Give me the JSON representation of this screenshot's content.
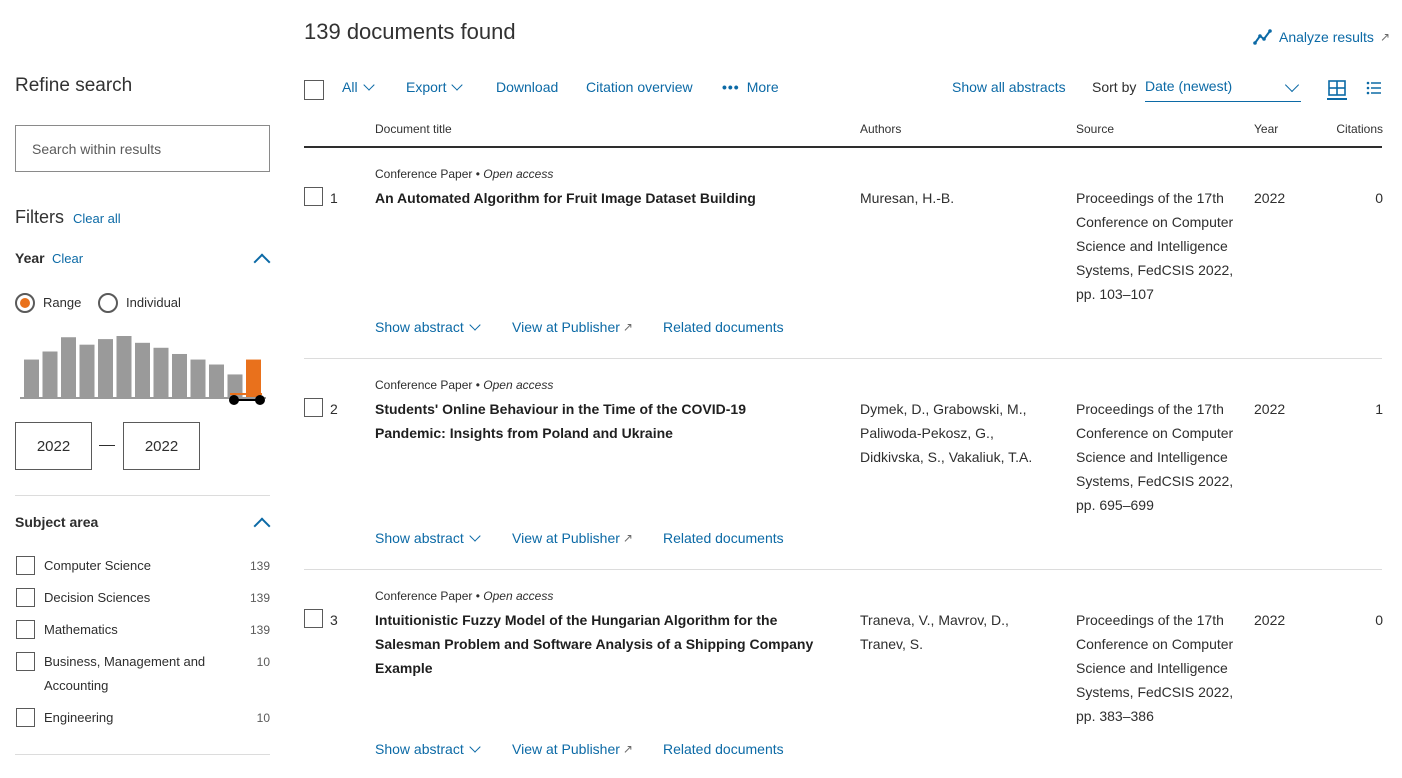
{
  "sidebar": {
    "refine_title": "Refine search",
    "search_placeholder": "Search within results",
    "filters_title": "Filters",
    "clear_all": "Clear all",
    "year": {
      "title": "Year",
      "clear": "Clear",
      "range_label": "Range",
      "individual_label": "Individual",
      "from": "2022",
      "to": "2022",
      "histogram_values": [
        0.62,
        0.75,
        0.98,
        0.86,
        0.95,
        1.0,
        0.89,
        0.81,
        0.71,
        0.62,
        0.54,
        0.38,
        0.62
      ]
    },
    "subject_title": "Subject area",
    "subjects": [
      {
        "label": "Computer Science",
        "count": "139"
      },
      {
        "label": "Decision Sciences",
        "count": "139"
      },
      {
        "label": "Mathematics",
        "count": "139"
      },
      {
        "label": "Business, Management and Accounting",
        "count": "10"
      },
      {
        "label": "Engineering",
        "count": "10"
      }
    ]
  },
  "main": {
    "found_title": "139 documents found",
    "analyze": "Analyze results",
    "toolbar": {
      "all": "All",
      "export": "Export",
      "download": "Download",
      "citation_overview": "Citation overview",
      "more": "More",
      "show_all_abstracts": "Show all abstracts",
      "sort_by": "Sort by",
      "sort_value": "Date (newest)"
    },
    "columns": {
      "title": "Document title",
      "authors": "Authors",
      "source": "Source",
      "year": "Year",
      "citations": "Citations"
    },
    "row_links": {
      "show_abstract": "Show abstract",
      "view_publisher": "View at Publisher",
      "related": "Related documents"
    },
    "rows": [
      {
        "num": "1",
        "type": "Conference Paper",
        "access": "Open access",
        "title": "An Automated Algorithm for Fruit Image Dataset Building",
        "authors": "Muresan, H.-B.",
        "source": "Proceedings of the 17th Conference on Computer Science and Intelligence Systems, FedCSIS 2022, pp. 103–107",
        "year": "2022",
        "citations": "0"
      },
      {
        "num": "2",
        "type": "Conference Paper",
        "access": "Open access",
        "title": "Students' Online Behaviour in the Time of the COVID-19 Pandemic: Insights from Poland and Ukraine",
        "authors": "Dymek, D., Grabowski, M., Paliwoda-Pekosz, G., Didkivska, S., Vakaliuk, T.A.",
        "source": "Proceedings of the 17th Conference on Computer Science and Intelligence Systems, FedCSIS 2022, pp. 695–699",
        "year": "2022",
        "citations": "1"
      },
      {
        "num": "3",
        "type": "Conference Paper",
        "access": "Open access",
        "title": "Intuitionistic Fuzzy Model of the Hungarian Algorithm for the Salesman Problem and Software Analysis of a Shipping Company Example",
        "authors": "Traneva, V., Mavrov, D., Tranev, S.",
        "source": "Proceedings of the 17th Conference on Computer Science and Intelligence Systems, FedCSIS 2022, pp. 383–386",
        "year": "2022",
        "citations": "0"
      }
    ]
  },
  "colors": {
    "link": "#0c6aa6",
    "accent": "#e9711c",
    "bar": "#9a9a9a"
  }
}
